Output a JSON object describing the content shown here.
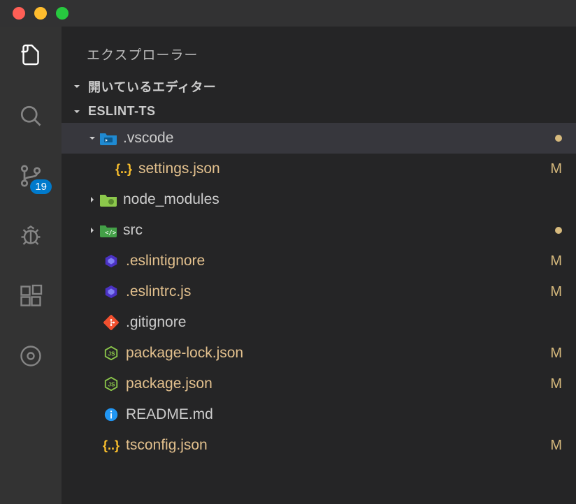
{
  "titlebar": {},
  "activityBar": {
    "sourceControlBadge": "19"
  },
  "sidebar": {
    "title": "エクスプローラー",
    "openEditorsLabel": "開いているエディター",
    "workspaceLabel": "ESLINT-TS"
  },
  "tree": {
    "vscodeFolder": {
      "name": ".vscode",
      "status": "dot"
    },
    "settingsJson": {
      "name": "settings.json",
      "status": "M"
    },
    "nodeModules": {
      "name": "node_modules",
      "status": ""
    },
    "srcFolder": {
      "name": "src",
      "status": "dot"
    },
    "eslintignore": {
      "name": ".eslintignore",
      "status": "M"
    },
    "eslintrc": {
      "name": ".eslintrc.js",
      "status": "M"
    },
    "gitignore": {
      "name": ".gitignore",
      "status": ""
    },
    "packageLock": {
      "name": "package-lock.json",
      "status": "M"
    },
    "packageJson": {
      "name": "package.json",
      "status": "M"
    },
    "readme": {
      "name": "README.md",
      "status": ""
    },
    "tsconfig": {
      "name": "tsconfig.json",
      "status": "M"
    }
  }
}
